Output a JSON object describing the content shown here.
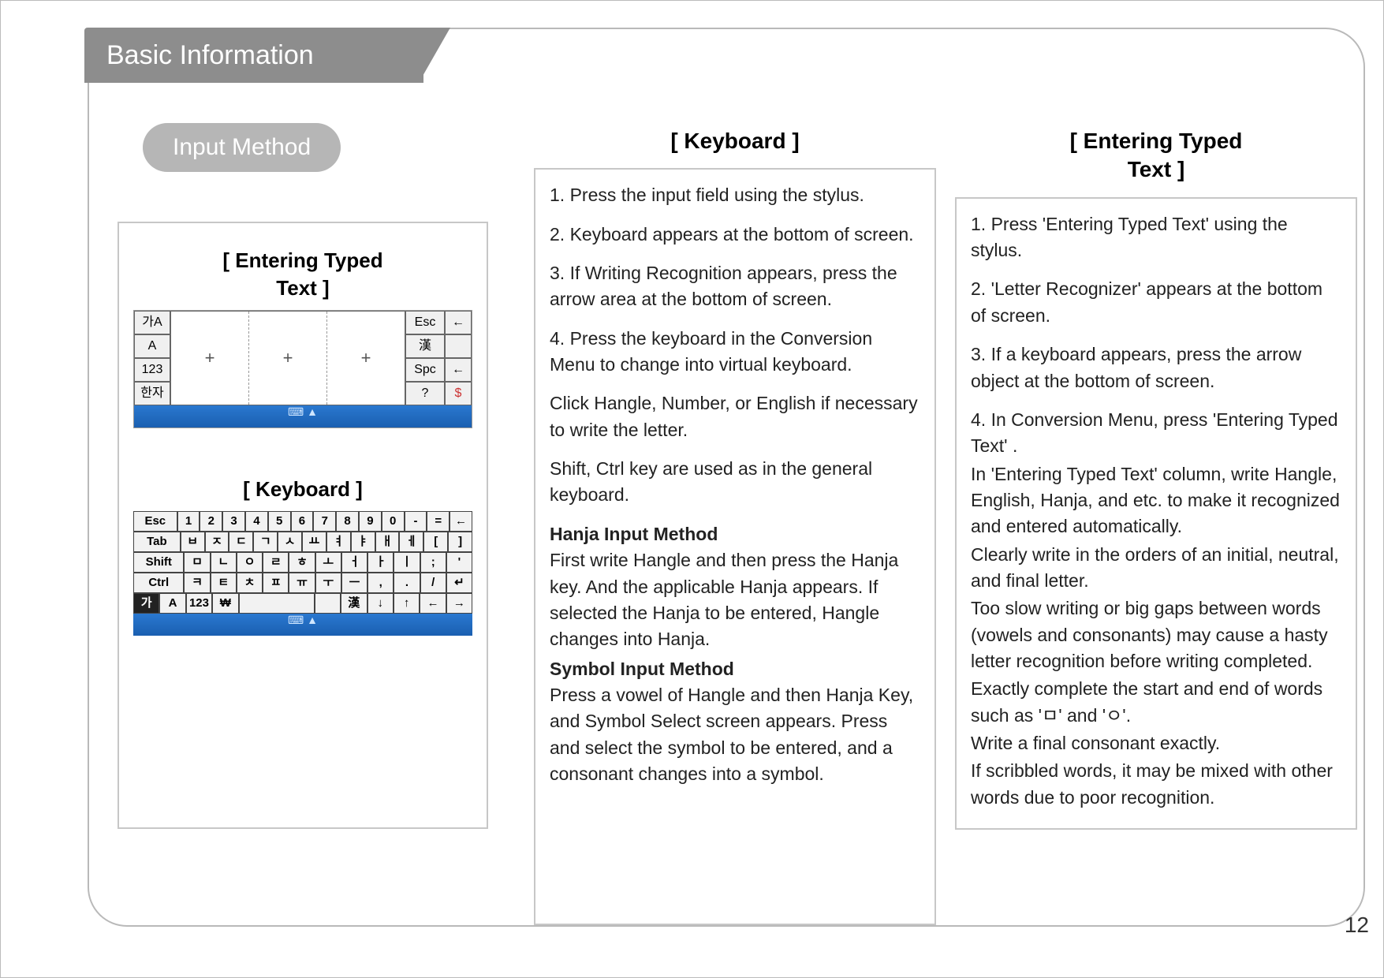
{
  "header": {
    "title": "Basic Information"
  },
  "pill": {
    "label": "Input Method"
  },
  "page_number": "12",
  "left_panel": {
    "title1": "[ Entering Typed\nText ]",
    "title2": "[ Keyboard ]",
    "recognizer_side_left": [
      "가A",
      "A",
      "123",
      "한자"
    ],
    "recognizer_side_right": [
      "Esc",
      "漢",
      "Spc",
      "?"
    ],
    "recognizer_right_icons": [
      "←",
      " ",
      "←",
      "$"
    ],
    "keyboard_rows": [
      [
        "Esc",
        "1",
        "2",
        "3",
        "4",
        "5",
        "6",
        "7",
        "8",
        "9",
        "0",
        "-",
        "=",
        "←"
      ],
      [
        "Tab",
        "ㅂ",
        "ㅈ",
        "ㄷ",
        "ㄱ",
        "ㅅ",
        "ㅛ",
        "ㅕ",
        "ㅑ",
        "ㅐ",
        "ㅔ",
        "[",
        "]"
      ],
      [
        "Shift",
        "ㅁ",
        "ㄴ",
        "ㅇ",
        "ㄹ",
        "ㅎ",
        "ㅗ",
        "ㅓ",
        "ㅏ",
        "ㅣ",
        ";",
        "'"
      ],
      [
        "Ctrl",
        "ㅋ",
        "ㅌ",
        "ㅊ",
        "ㅍ",
        "ㅠ",
        "ㅜ",
        "ㅡ",
        ",",
        ".",
        "/",
        "↵"
      ],
      [
        "가",
        "A",
        "123",
        "₩",
        "",
        "",
        "漢",
        "↓",
        "↑",
        "←",
        "→"
      ]
    ]
  },
  "column_keyboard": {
    "title": "[ Keyboard ]",
    "items": [
      "1. Press the input field using the stylus.",
      "2. Keyboard appears at the bottom of screen.",
      "3. If Writing Recognition appears, press the arrow area at the bottom of screen.",
      "4. Press the keyboard in the Conversion Menu to change into virtual keyboard.",
      "Click Hangle, Number, or English if necessary to write the letter.",
      "Shift, Ctrl key are used as in the general keyboard."
    ],
    "hanja_head": "Hanja Input Method",
    "hanja_body": "First write Hangle and then press the Hanja key. And the applicable Hanja appears. If selected the Hanja to be entered, Hangle changes into Hanja.",
    "symbol_head": "Symbol Input Method",
    "symbol_body": "Press a vowel of Hangle and then Hanja Key, and Symbol Select screen appears. Press and select the symbol to be entered, and a consonant changes into a symbol."
  },
  "column_typed": {
    "title": "[ Entering Typed\nText ]",
    "items": [
      "1. Press 'Entering Typed Text' using the stylus.",
      "2. 'Letter Recognizer' appears at the bottom of screen.",
      "3. If a keyboard appears, press the arrow object at the bottom of screen.",
      "4. In Conversion Menu, press 'Entering Typed Text' ."
    ],
    "tail": [
      "In 'Entering Typed Text' column, write Hangle, English, Hanja, and etc. to make it recognized and entered automatically.",
      "Clearly write in the orders of an initial, neutral, and final letter.",
      "Too slow writing or big gaps between words (vowels and consonants) may cause a hasty letter recognition before writing completed.",
      "Exactly complete the start and end of words such as 'ㅁ' and 'ㅇ'.",
      "Write a final consonant exactly.",
      "If scribbled words, it may be mixed with other words due to poor recognition."
    ]
  }
}
